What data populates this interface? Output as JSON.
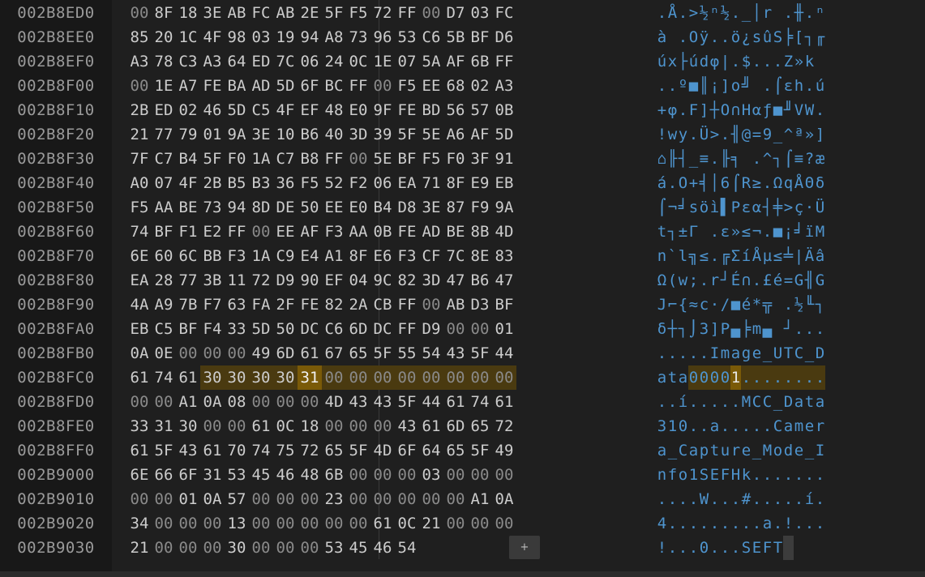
{
  "add_button_label": "+",
  "rows": [
    {
      "addr": "002B8ED0",
      "bytes": [
        "00",
        "8F",
        "18",
        "3E",
        "AB",
        "FC",
        "AB",
        "2E",
        "5F",
        "F5",
        "72",
        "FF",
        "00",
        "D7",
        "03",
        "FC"
      ],
      "ascii": ".Å.>½ⁿ½._│r .╫.ⁿ"
    },
    {
      "addr": "002B8EE0",
      "bytes": [
        "85",
        "20",
        "1C",
        "4F",
        "98",
        "03",
        "19",
        "94",
        "A8",
        "73",
        "96",
        "53",
        "C6",
        "5B",
        "BF",
        "D6"
      ],
      "ascii": "à .Oÿ..ö¿sûS╞[┐╓"
    },
    {
      "addr": "002B8EF0",
      "bytes": [
        "A3",
        "78",
        "C3",
        "A3",
        "64",
        "ED",
        "7C",
        "06",
        "24",
        "0C",
        "1E",
        "07",
        "5A",
        "AF",
        "6B",
        "FF"
      ],
      "ascii": "úx├údφ|.$...Z»k "
    },
    {
      "addr": "002B8F00",
      "bytes": [
        "00",
        "1E",
        "A7",
        "FE",
        "BA",
        "AD",
        "5D",
        "6F",
        "BC",
        "FF",
        "00",
        "F5",
        "EE",
        "68",
        "02",
        "A3"
      ],
      "ascii": "..º■║¡]o╝ .⌠εh.ú"
    },
    {
      "addr": "002B8F10",
      "bytes": [
        "2B",
        "ED",
        "02",
        "46",
        "5D",
        "C5",
        "4F",
        "EF",
        "48",
        "E0",
        "9F",
        "FE",
        "BD",
        "56",
        "57",
        "0B"
      ],
      "ascii": "+φ.F]┼O∩Hαƒ■╜VW."
    },
    {
      "addr": "002B8F20",
      "bytes": [
        "21",
        "77",
        "79",
        "01",
        "9A",
        "3E",
        "10",
        "B6",
        "40",
        "3D",
        "39",
        "5F",
        "5E",
        "A6",
        "AF",
        "5D"
      ],
      "ascii": "!wy.Ü>.╢@=9_^ª»]"
    },
    {
      "addr": "002B8F30",
      "bytes": [
        "7F",
        "C7",
        "B4",
        "5F",
        "F0",
        "1A",
        "C7",
        "B8",
        "FF",
        "00",
        "5E",
        "BF",
        "F5",
        "F0",
        "3F",
        "91"
      ],
      "ascii": "⌂╟┤_≡.╟╕ .^┐⌠≡?æ"
    },
    {
      "addr": "002B8F40",
      "bytes": [
        "A0",
        "07",
        "4F",
        "2B",
        "B5",
        "B3",
        "36",
        "F5",
        "52",
        "F2",
        "06",
        "EA",
        "71",
        "8F",
        "E9",
        "EB"
      ],
      "ascii": "á.O+╡│6⌠R≥.ΩqÅΘδ"
    },
    {
      "addr": "002B8F50",
      "bytes": [
        "F5",
        "AA",
        "BE",
        "73",
        "94",
        "8D",
        "DE",
        "50",
        "EE",
        "E0",
        "B4",
        "D8",
        "3E",
        "87",
        "F9",
        "9A"
      ],
      "ascii": "⌠¬╛söì▌Pεα┤╪>ç·Ü"
    },
    {
      "addr": "002B8F60",
      "bytes": [
        "74",
        "BF",
        "F1",
        "E2",
        "FF",
        "00",
        "EE",
        "AF",
        "F3",
        "AA",
        "0B",
        "FE",
        "AD",
        "BE",
        "8B",
        "4D"
      ],
      "ascii": "t┐±Γ .ε»≤¬.■¡╛ïM"
    },
    {
      "addr": "002B8F70",
      "bytes": [
        "6E",
        "60",
        "6C",
        "BB",
        "F3",
        "1A",
        "C9",
        "E4",
        "A1",
        "8F",
        "E6",
        "F3",
        "CF",
        "7C",
        "8E",
        "83"
      ],
      "ascii": "n`l╗≤.╔ΣíÅµ≤╧|Äâ"
    },
    {
      "addr": "002B8F80",
      "bytes": [
        "EA",
        "28",
        "77",
        "3B",
        "11",
        "72",
        "D9",
        "90",
        "EF",
        "04",
        "9C",
        "82",
        "3D",
        "47",
        "B6",
        "47"
      ],
      "ascii": "Ω(w;.r┘É∩.£é=G╢G"
    },
    {
      "addr": "002B8F90",
      "bytes": [
        "4A",
        "A9",
        "7B",
        "F7",
        "63",
        "FA",
        "2F",
        "FE",
        "82",
        "2A",
        "CB",
        "FF",
        "00",
        "AB",
        "D3",
        "BF"
      ],
      "ascii": "J⌐{≈c·/■é*╦ .½╙┐"
    },
    {
      "addr": "002B8FA0",
      "bytes": [
        "EB",
        "C5",
        "BF",
        "F4",
        "33",
        "5D",
        "50",
        "DC",
        "C6",
        "6D",
        "DC",
        "FF",
        "D9",
        "00",
        "00",
        "01"
      ],
      "ascii": "δ┼┐⌡3]P▄╞m▄ ┘..."
    },
    {
      "addr": "002B8FB0",
      "bytes": [
        "0A",
        "0E",
        "00",
        "00",
        "00",
        "49",
        "6D",
        "61",
        "67",
        "65",
        "5F",
        "55",
        "54",
        "43",
        "5F",
        "44"
      ],
      "ascii": ".....Image_UTC_D"
    },
    {
      "addr": "002B8FC0",
      "bytes": [
        "61",
        "74",
        "61",
        "30",
        "30",
        "30",
        "30",
        "31",
        "00",
        "00",
        "00",
        "00",
        "00",
        "00",
        "00",
        "00"
      ],
      "ascii": "ata00001........"
    },
    {
      "addr": "002B8FD0",
      "bytes": [
        "00",
        "00",
        "A1",
        "0A",
        "08",
        "00",
        "00",
        "00",
        "4D",
        "43",
        "43",
        "5F",
        "44",
        "61",
        "74",
        "61"
      ],
      "ascii": "..í.....MCC_Data"
    },
    {
      "addr": "002B8FE0",
      "bytes": [
        "33",
        "31",
        "30",
        "00",
        "00",
        "61",
        "0C",
        "18",
        "00",
        "00",
        "00",
        "43",
        "61",
        "6D",
        "65",
        "72"
      ],
      "ascii": "310..a.....Camer"
    },
    {
      "addr": "002B8FF0",
      "bytes": [
        "61",
        "5F",
        "43",
        "61",
        "70",
        "74",
        "75",
        "72",
        "65",
        "5F",
        "4D",
        "6F",
        "64",
        "65",
        "5F",
        "49"
      ],
      "ascii": "a_Capture_Mode_I"
    },
    {
      "addr": "002B9000",
      "bytes": [
        "6E",
        "66",
        "6F",
        "31",
        "53",
        "45",
        "46",
        "48",
        "6B",
        "00",
        "00",
        "00",
        "03",
        "00",
        "00",
        "00"
      ],
      "ascii": "nfo1SEFHk......."
    },
    {
      "addr": "002B9010",
      "bytes": [
        "00",
        "00",
        "01",
        "0A",
        "57",
        "00",
        "00",
        "00",
        "23",
        "00",
        "00",
        "00",
        "00",
        "00",
        "A1",
        "0A"
      ],
      "ascii": "....W...#.....í."
    },
    {
      "addr": "002B9020",
      "bytes": [
        "34",
        "00",
        "00",
        "00",
        "13",
        "00",
        "00",
        "00",
        "00",
        "00",
        "61",
        "0C",
        "21",
        "00",
        "00",
        "00"
      ],
      "ascii": "4.........a.!..."
    },
    {
      "addr": "002B9030",
      "bytes": [
        "21",
        "00",
        "00",
        "00",
        "30",
        "00",
        "00",
        "00",
        "53",
        "45",
        "46",
        "54"
      ],
      "ascii": "!...0...SEFT"
    }
  ]
}
